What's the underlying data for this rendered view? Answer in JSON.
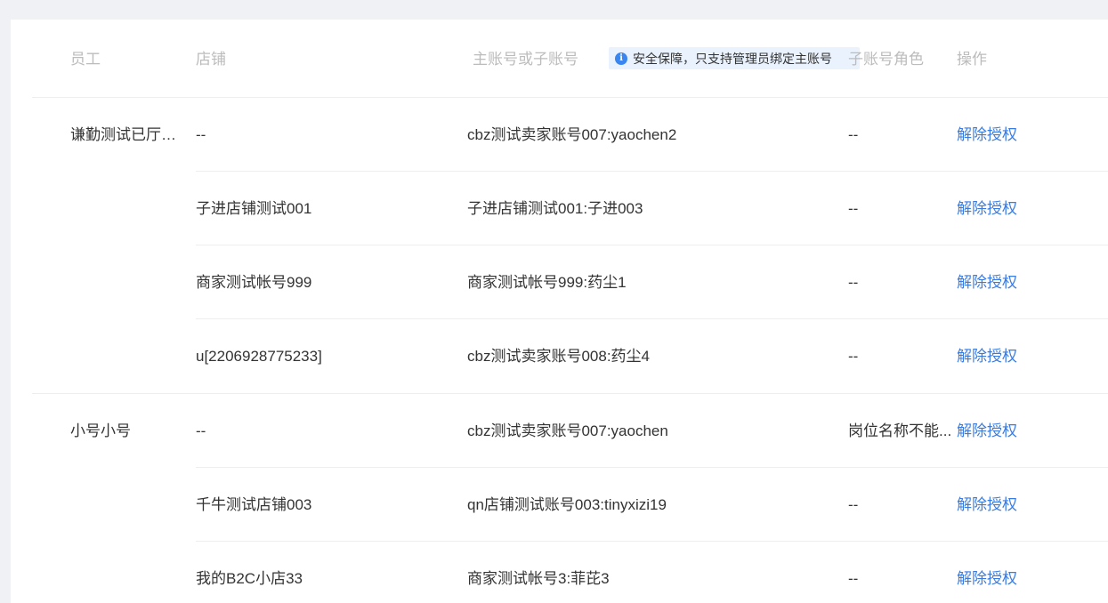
{
  "table": {
    "headers": {
      "employee": "员工",
      "shop": "店铺",
      "account": "主账号或子账号",
      "role": "子账号角色",
      "action": "操作"
    },
    "notice": "安全保障，只支持管理员绑定主账号",
    "groups": [
      {
        "employee": "谦勤测试已厅的...",
        "rows": [
          {
            "shop": "--",
            "account": "cbz测试卖家账号007:yaochen2",
            "role": "--",
            "action": "解除授权"
          },
          {
            "shop": "子进店铺测试001",
            "account": "子进店铺测试001:子进003",
            "role": "--",
            "action": "解除授权"
          },
          {
            "shop": "商家测试帐号999",
            "account": "商家测试帐号999:药尘1",
            "role": "--",
            "action": "解除授权"
          },
          {
            "shop": "u[2206928775233]",
            "account": "cbz测试卖家账号008:药尘4",
            "role": "--",
            "action": "解除授权"
          }
        ]
      },
      {
        "employee": "小号小号",
        "rows": [
          {
            "shop": "--",
            "account": "cbz测试卖家账号007:yaochen",
            "role": "岗位名称不能...",
            "action": "解除授权"
          },
          {
            "shop": "千牛测试店铺003",
            "account": "qn店铺测试账号003:tinyxizi19",
            "role": "--",
            "action": "解除授权"
          },
          {
            "shop": "我的B2C小店33",
            "account": "商家测试帐号3:菲芘3",
            "role": "--",
            "action": "解除授权"
          }
        ]
      }
    ]
  }
}
